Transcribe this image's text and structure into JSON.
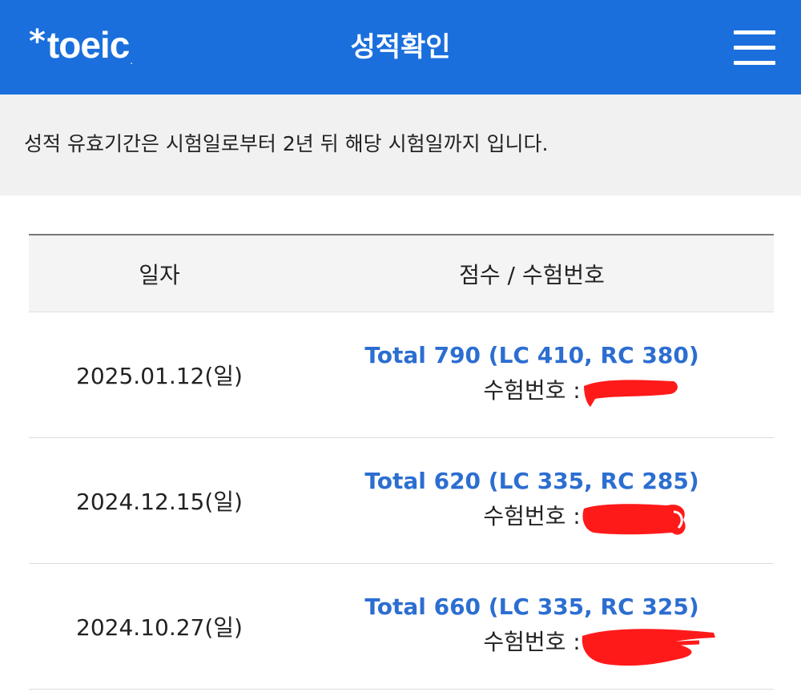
{
  "header": {
    "logo_star": "*",
    "logo_text": "toeic",
    "logo_dot": ".",
    "title": "성적확인",
    "menu_icon": "hamburger-menu-icon",
    "background_color": "#1a6fdc"
  },
  "notice": {
    "text": "성적 유효기간은 시험일로부터 2년 뒤 해당 시험일까지 입니다."
  },
  "table": {
    "headers": {
      "date": "일자",
      "score": "점수 / 수험번호"
    },
    "rows": [
      {
        "date": "2025.01.12(일)",
        "score": "Total 790 (LC 410, RC 380)",
        "reg_label": "수험번호 :"
      },
      {
        "date": "2024.12.15(일)",
        "score": "Total 620 (LC 335, RC 285)",
        "reg_label": "수험번호 :"
      },
      {
        "date": "2024.10.27(일)",
        "score": "Total 660 (LC 335, RC 325)",
        "reg_label": "수험번호 :"
      }
    ],
    "score_color": "#2c6ed1",
    "redaction_color": "#ff1a1a"
  }
}
